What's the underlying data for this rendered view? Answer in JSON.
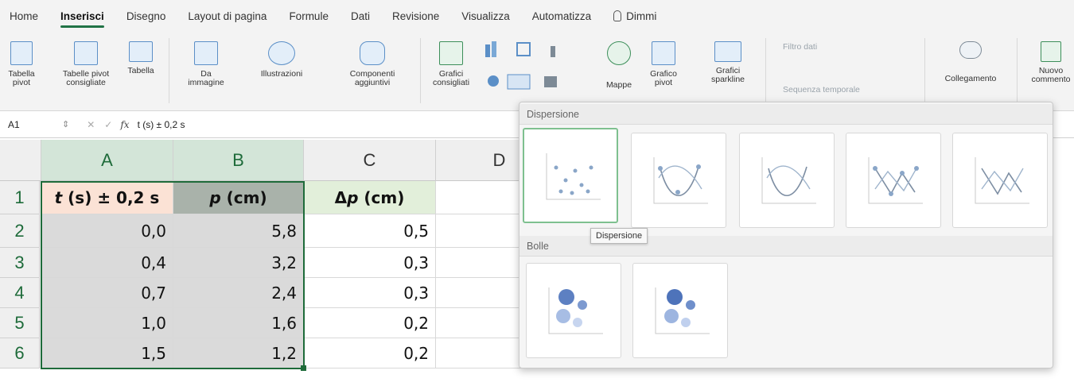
{
  "tabs": [
    "Home",
    "Inserisci",
    "Disegno",
    "Layout di pagina",
    "Formule",
    "Dati",
    "Revisione",
    "Visualizza",
    "Automatizza"
  ],
  "tell_me": "Dimmi",
  "ribbon": {
    "pivot": "Tabella pivot",
    "pivot_line1": "Tabella",
    "pivot_line2": "pivot",
    "pivot_sugg_line1": "Tabelle pivot",
    "pivot_sugg_line2": "consigliate",
    "table": "Tabella",
    "from_image_line1": "Da",
    "from_image_line2": "immagine",
    "illustrations": "Illustrazioni",
    "addins_line1": "Componenti",
    "addins_line2": "aggiuntivi",
    "rec_charts_line1": "Grafici",
    "rec_charts_line2": "consigliati",
    "maps": "Mappe",
    "pivot_chart_line1": "Grafico",
    "pivot_chart_line2": "pivot",
    "sparklines_line1": "Grafici",
    "sparklines_line2": "sparkline",
    "slicer": "Filtro dati",
    "timeline": "Sequenza temporale",
    "link": "Collegamento",
    "new_comment_line1": "Nuovo",
    "new_comment_line2": "commento"
  },
  "formula_bar": {
    "name_box": "A1",
    "fx": "fx",
    "content": "t (s) ± 0,2 s"
  },
  "columns": [
    "A",
    "B",
    "C",
    "D"
  ],
  "rows": [
    "1",
    "2",
    "3",
    "4",
    "5",
    "6"
  ],
  "headers": {
    "a_var": "t",
    "a_rest": " (s) ± 0,2 s",
    "b_var": "p",
    "b_rest": " (cm)",
    "c_delta": "Δ",
    "c_var": "p",
    "c_rest": " (cm)"
  },
  "table": [
    [
      "0,0",
      "5,8",
      "0,5"
    ],
    [
      "0,4",
      "3,2",
      "0,3"
    ],
    [
      "0,7",
      "2,4",
      "0,3"
    ],
    [
      "1,0",
      "1,6",
      "0,2"
    ],
    [
      "1,5",
      "1,2",
      "0,2"
    ]
  ],
  "dropdown": {
    "scatter_title": "Dispersione",
    "bubble_title": "Bolle",
    "tooltip": "Dispersione"
  },
  "colors": {
    "accent": "#217346",
    "selection": "#dadada",
    "header_green": "#e2efda",
    "header_gray": "#a9b2aa"
  }
}
